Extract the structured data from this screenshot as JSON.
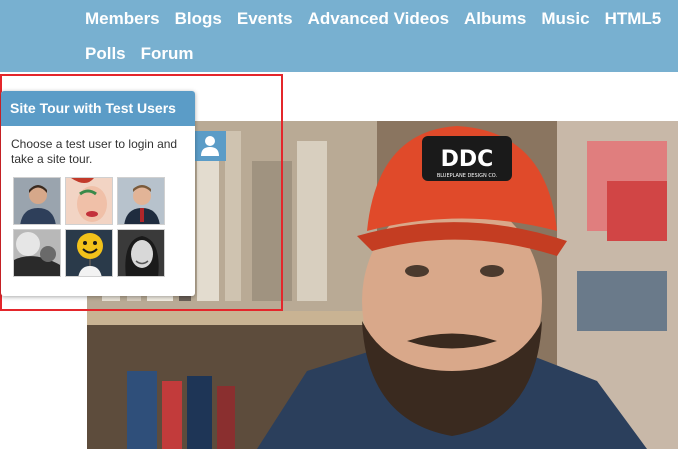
{
  "nav": {
    "row1": [
      "Members",
      "Blogs",
      "Events",
      "Advanced Videos",
      "Albums",
      "Music",
      "HTML5"
    ],
    "row2": [
      "Polls",
      "Forum"
    ]
  },
  "site_tour": {
    "title": "Site Tour with Test Users",
    "description": "Choose a test user to login and take a site tour.",
    "users": [
      {
        "icon": "user-avatar-man-suit"
      },
      {
        "icon": "user-avatar-woman-makeup"
      },
      {
        "icon": "user-avatar-man-tie"
      },
      {
        "icon": "user-avatar-grayscale-abstract"
      },
      {
        "icon": "user-avatar-smiley-balloon"
      },
      {
        "icon": "user-avatar-woman-bw"
      }
    ],
    "toggle_icon": "user-icon"
  },
  "hero": {
    "cap_text": "DDC",
    "cap_subtext": "BLUEPLANE DESIGN CO."
  },
  "colors": {
    "nav_bg": "#78b0d0",
    "panel_header": "#5b9cc7",
    "highlight_border": "#e4262b"
  }
}
